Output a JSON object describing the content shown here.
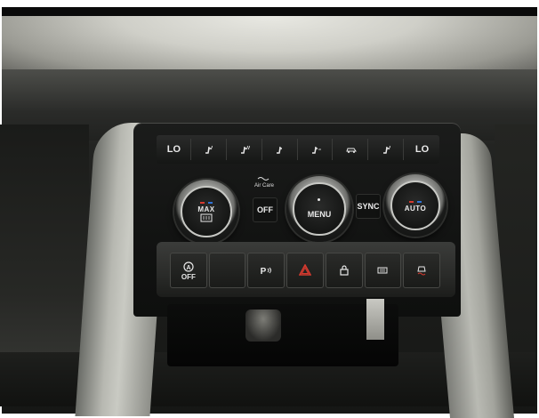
{
  "top_strip": {
    "buttons": [
      {
        "label": "LO",
        "icon": "temp-left-lo"
      },
      {
        "label": "",
        "icon": "seat-heat-icon"
      },
      {
        "label": "",
        "icon": "seat-heat-icon"
      },
      {
        "label": "",
        "icon": "seat-heat-icon"
      },
      {
        "label": "",
        "icon": "seat-heat-icon"
      },
      {
        "label": "",
        "icon": "car-recirc-icon"
      },
      {
        "label": "",
        "icon": "seat-heat-icon"
      },
      {
        "label": "LO",
        "icon": "temp-right-lo"
      }
    ]
  },
  "controls": {
    "air_care": "Air Care",
    "off": "OFF",
    "menu": "MENU",
    "sync": "SYNC",
    "max": "MAX",
    "auto": "AUTO"
  },
  "lower_buttons": [
    {
      "label": "OFF",
      "icon": "auto-start-stop-icon"
    },
    {
      "label": "",
      "icon": "blank-button"
    },
    {
      "label": "",
      "icon": "park-assist-icon"
    },
    {
      "label": "",
      "icon": "hazard-icon"
    },
    {
      "label": "",
      "icon": "lock-icon"
    },
    {
      "label": "",
      "icon": "drive-mode-icon"
    },
    {
      "label": "",
      "icon": "traction-off-icon"
    }
  ],
  "colors": {
    "hazard_red": "#d63a2f",
    "heat_red": "#d63a2f",
    "cool_blue": "#2f72d6"
  }
}
